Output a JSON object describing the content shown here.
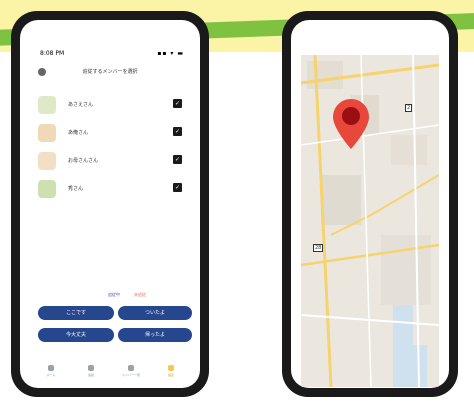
{
  "phones": {
    "left": {
      "status": {
        "time": "8:08 PM",
        "icons": "▪▪ ▾ ▬"
      },
      "header": {
        "title": "追従するメンバーを選択"
      },
      "members": [
        {
          "name": "あさえさん",
          "checked": true,
          "avatar_color": "#dfe8c7"
        },
        {
          "name": "あ俺さん",
          "checked": true,
          "avatar_color": "#f0d9b7"
        },
        {
          "name": "お母さんさん",
          "checked": true,
          "avatar_color": "#f2dfc5"
        },
        {
          "name": "秀さん",
          "checked": true,
          "avatar_color": "#cfe0b0"
        }
      ],
      "legend": {
        "a": "追従中",
        "b": "未追従"
      },
      "buttons": [
        "ここです",
        "ついたよ",
        "今大丈夫",
        "帰ったよ"
      ],
      "tabs": [
        {
          "label": "ホーム",
          "active": false
        },
        {
          "label": "追従",
          "active": false
        },
        {
          "label": "メンバー一覧",
          "active": false
        },
        {
          "label": "設定",
          "active": true
        }
      ]
    },
    "right": {
      "map": {
        "badges": [
          "2",
          "28"
        ],
        "pin_color": "#e8473c"
      }
    }
  }
}
